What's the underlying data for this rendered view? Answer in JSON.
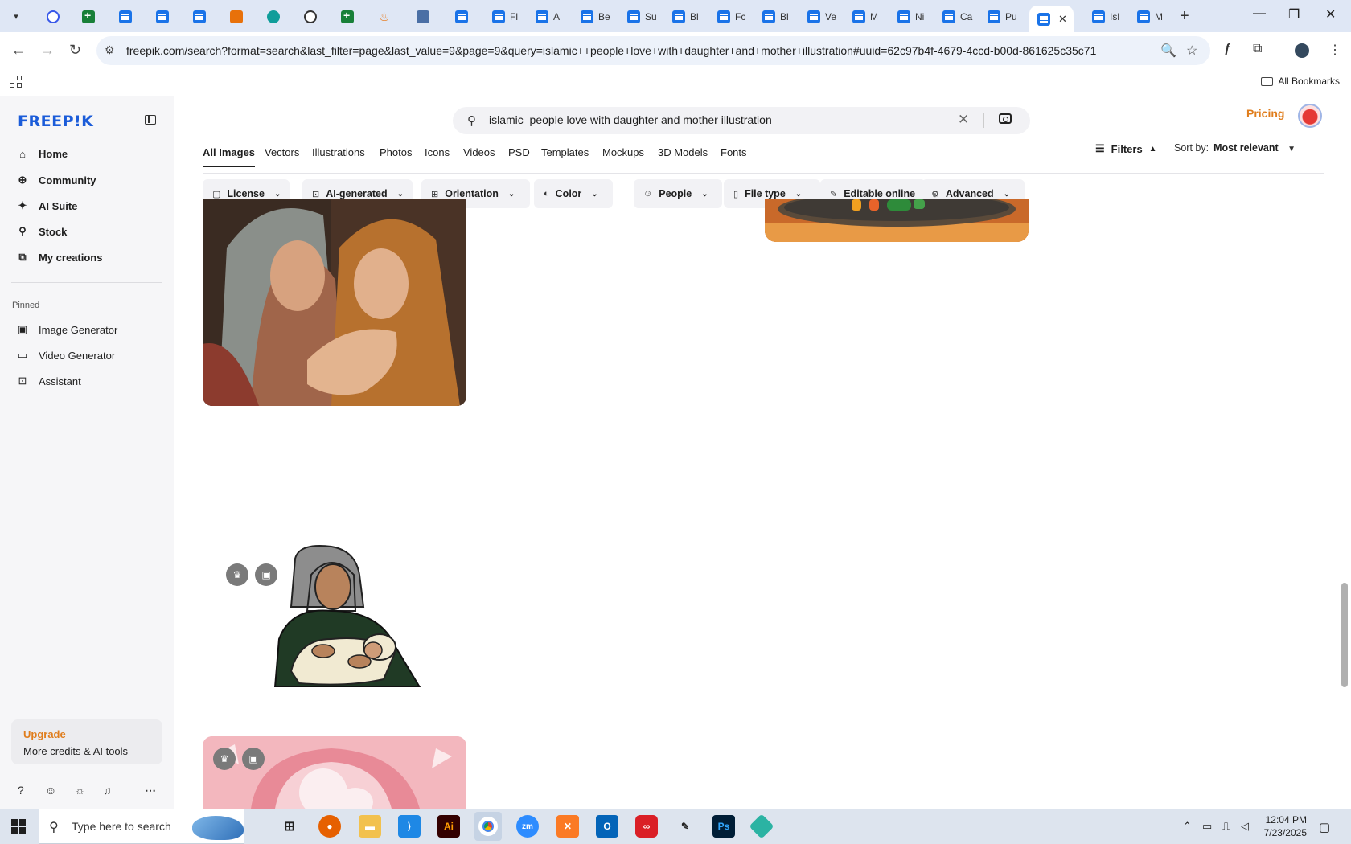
{
  "browser": {
    "tabs": [
      {
        "label": "",
        "icon": "wordpress-icon"
      },
      {
        "label": "",
        "icon": "sheets-icon"
      },
      {
        "label": "",
        "icon": "docs-icon"
      },
      {
        "label": "",
        "icon": "docs-icon"
      },
      {
        "label": "",
        "icon": "docs-icon"
      },
      {
        "label": "",
        "icon": "xampp-icon"
      },
      {
        "label": "",
        "icon": "teal-icon"
      },
      {
        "label": "",
        "icon": "chatgpt-icon"
      },
      {
        "label": "",
        "icon": "sheets-icon"
      },
      {
        "label": "",
        "icon": "flame-icon"
      },
      {
        "label": "",
        "icon": "grid-icon"
      },
      {
        "label": "",
        "icon": "docs-icon"
      },
      {
        "label": "Fl",
        "icon": "docs-icon"
      },
      {
        "label": "A",
        "icon": "docs-icon"
      },
      {
        "label": "Be",
        "icon": "docs-icon"
      },
      {
        "label": "Su",
        "icon": "docs-icon"
      },
      {
        "label": "Bl",
        "icon": "docs-icon"
      },
      {
        "label": "Fc",
        "icon": "docs-icon"
      },
      {
        "label": "Bl",
        "icon": "docs-icon"
      },
      {
        "label": "Ve",
        "icon": "docs-icon"
      },
      {
        "label": "M",
        "icon": "docs-icon"
      },
      {
        "label": "Ni",
        "icon": "docs-icon"
      },
      {
        "label": "Ca",
        "icon": "docs-icon"
      },
      {
        "label": "Pu",
        "icon": "docs-icon"
      },
      {
        "label": "",
        "icon": "docs-icon",
        "active": true
      },
      {
        "label": "Isl",
        "icon": "docs-icon"
      },
      {
        "label": "M",
        "icon": "docs-icon"
      }
    ],
    "url": "freepik.com/search?format=search&last_filter=page&last_value=9&page=9&query=islamic++people+love+with+daughter+and+mother+illustration#uuid=62c97b4f-4679-4ccd-b00d-861625c35c71",
    "bookmarks_label": "All Bookmarks"
  },
  "sidebar": {
    "logo": "FREEP!K",
    "nav": [
      {
        "label": "Home",
        "icon": "home-icon"
      },
      {
        "label": "Community",
        "icon": "globe-icon"
      },
      {
        "label": "AI Suite",
        "icon": "sparkle-icon"
      },
      {
        "label": "Stock",
        "icon": "search-icon"
      },
      {
        "label": "My creations",
        "icon": "creations-icon"
      }
    ],
    "pinned_title": "Pinned",
    "pinned": [
      {
        "label": "Image Generator",
        "icon": "image-icon"
      },
      {
        "label": "Video Generator",
        "icon": "video-icon"
      },
      {
        "label": "Assistant",
        "icon": "assistant-icon"
      }
    ],
    "upgrade": {
      "title": "Upgrade",
      "subtitle": "More credits & AI tools"
    }
  },
  "main": {
    "search_value": "islamic  people love with daughter and mother illustration",
    "pricing": "Pricing",
    "tabs": [
      "All Images",
      "Vectors",
      "Illustrations",
      "Photos",
      "Icons",
      "Videos",
      "PSD",
      "Templates",
      "Mockups",
      "3D Models",
      "Fonts"
    ],
    "filters_label": "Filters",
    "sort_label": "Sort by:",
    "sort_value": "Most relevant",
    "chips": [
      "License",
      "AI-generated",
      "Orientation",
      "Color",
      "People",
      "File type",
      "Editable online",
      "Advanced"
    ]
  },
  "taskbar": {
    "search_placeholder": "Type here to search",
    "time": "12:04 PM",
    "date": "7/23/2025"
  },
  "colors": {
    "brand": "#1b5cd9",
    "accent": "#e07d1c"
  }
}
